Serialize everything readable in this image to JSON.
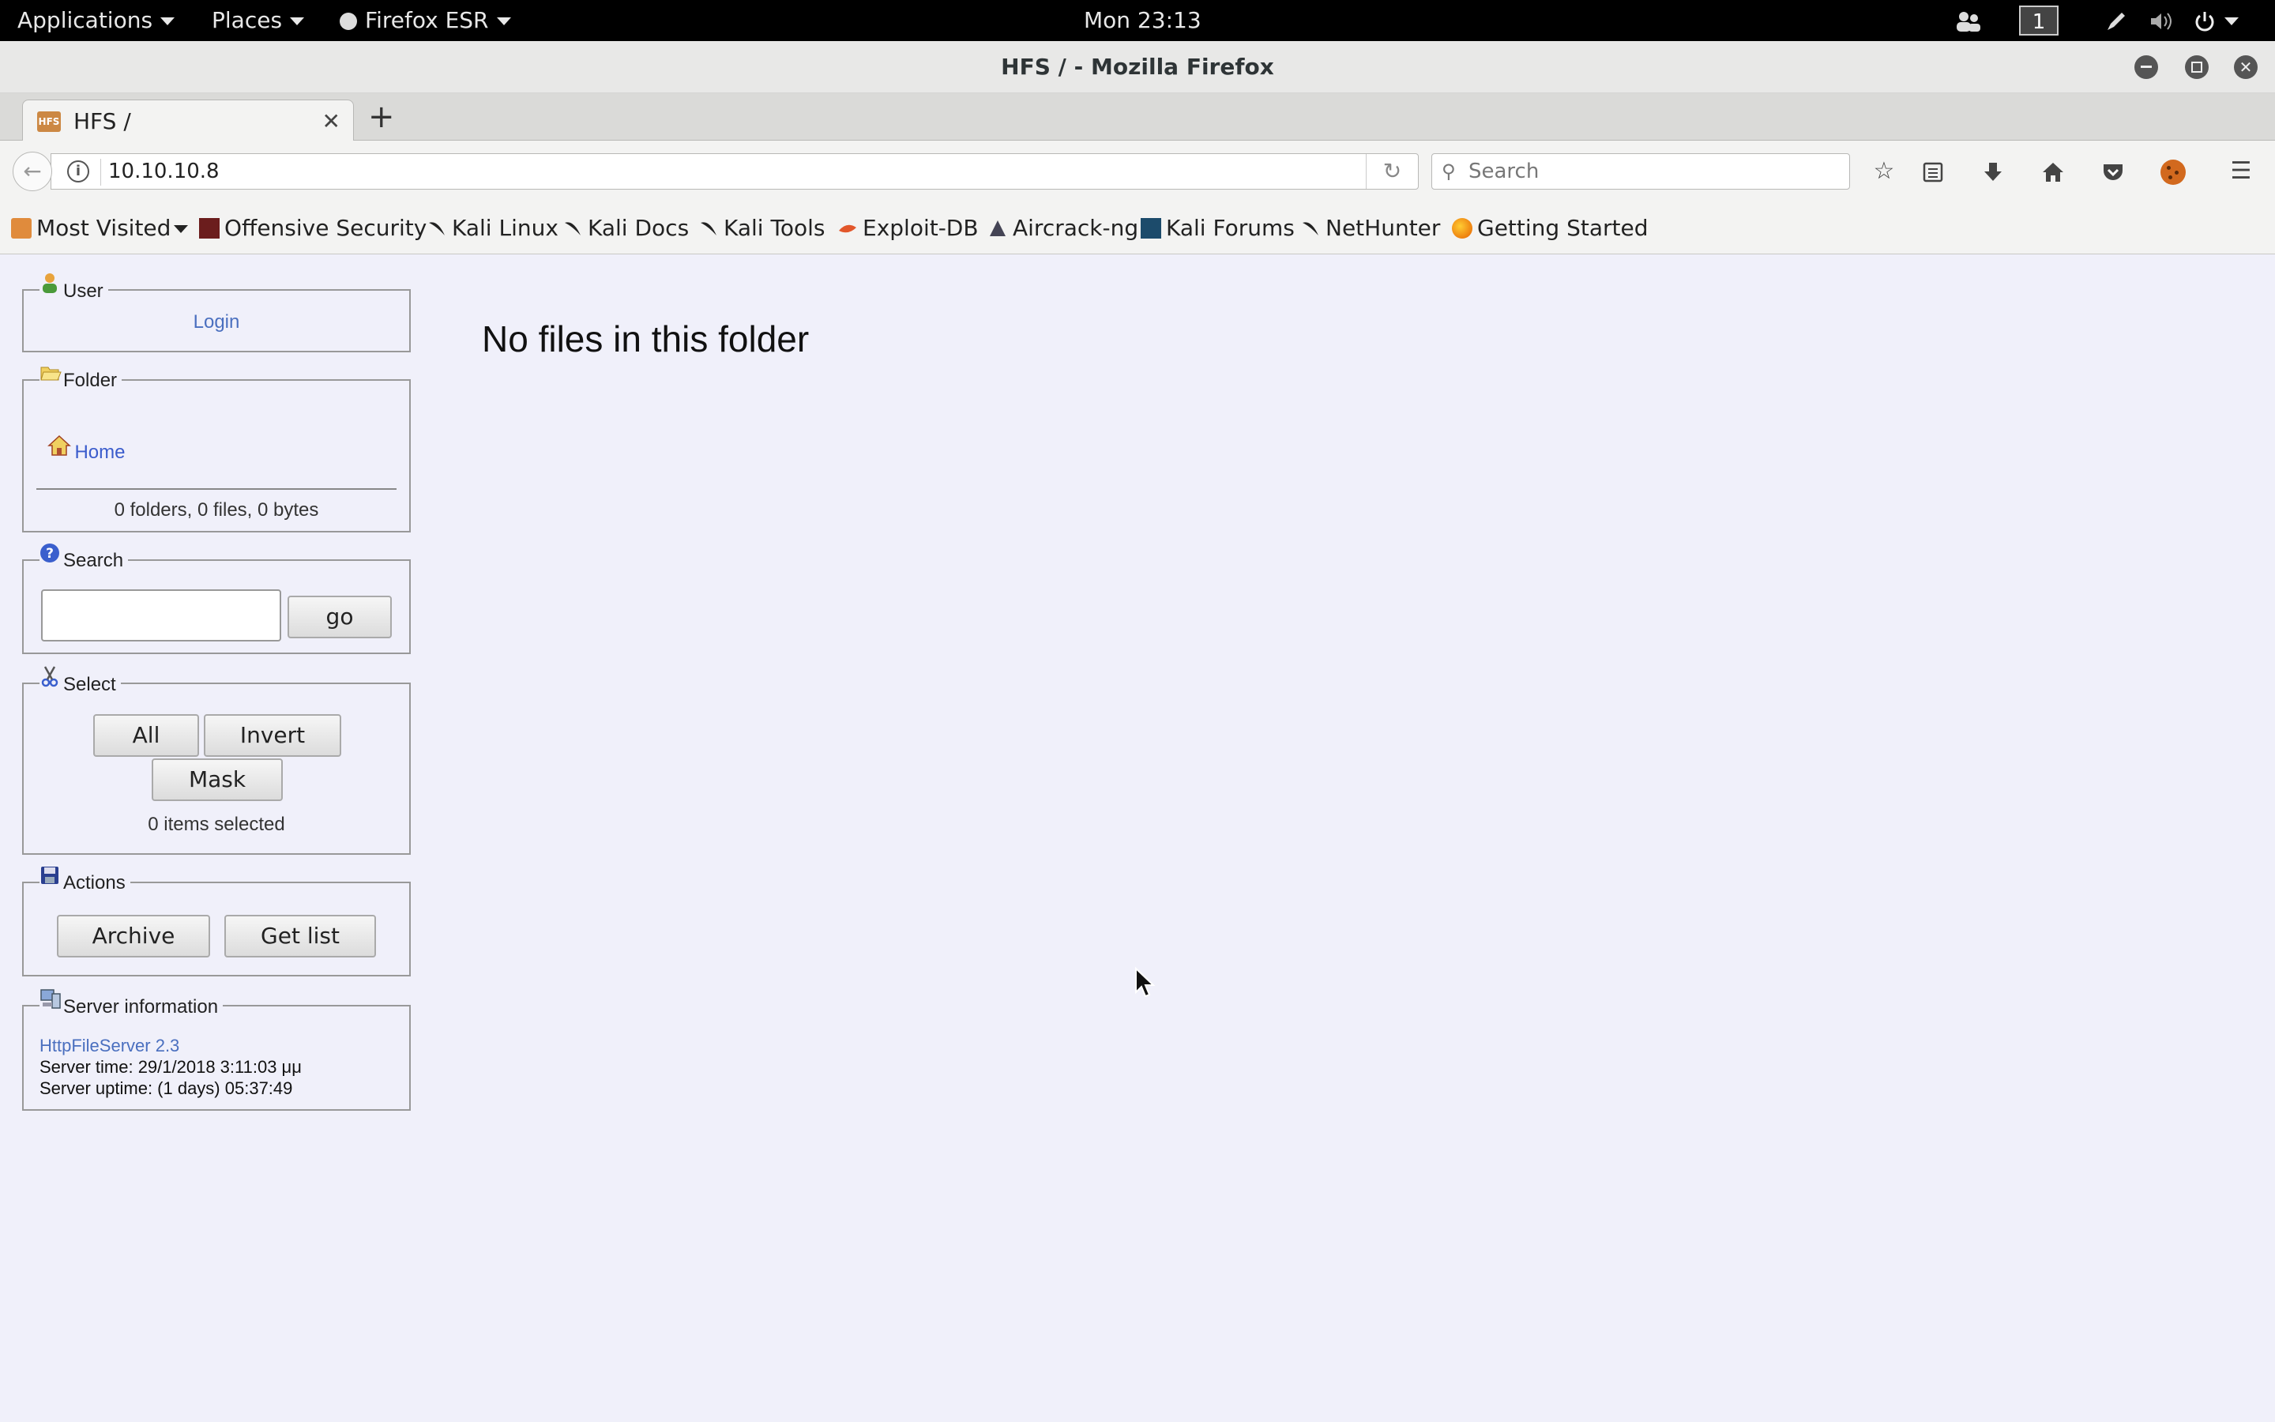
{
  "topbar": {
    "applications": "Applications",
    "places": "Places",
    "browser": "Firefox ESR",
    "clock": "Mon 23:13",
    "workspace": "1"
  },
  "window": {
    "title": "HFS / - Mozilla Firefox"
  },
  "tab": {
    "title": "HFS /",
    "favicon_text": "HFS"
  },
  "navbar": {
    "url": "10.10.10.8",
    "search_placeholder": "Search"
  },
  "bookmarks": [
    {
      "label": "Most Visited",
      "icon": "most-visited-icon"
    },
    {
      "label": "Offensive Security",
      "icon": "offsec-icon"
    },
    {
      "label": "Kali Linux",
      "icon": "kali-icon"
    },
    {
      "label": "Kali Docs",
      "icon": "kali-icon"
    },
    {
      "label": "Kali Tools",
      "icon": "kali-icon"
    },
    {
      "label": "Exploit-DB",
      "icon": "exploitdb-icon"
    },
    {
      "label": "Aircrack-ng",
      "icon": "aircrack-icon"
    },
    {
      "label": "Kali Forums",
      "icon": "kali-forums-icon"
    },
    {
      "label": "NetHunter",
      "icon": "kali-icon"
    },
    {
      "label": "Getting Started",
      "icon": "firefox-icon"
    }
  ],
  "sidebar": {
    "user": {
      "title": "User",
      "login": "Login"
    },
    "folder": {
      "title": "Folder",
      "home": "Home",
      "stats": "0 folders, 0 files, 0 bytes"
    },
    "search": {
      "title": "Search",
      "value": "",
      "go": "go"
    },
    "select": {
      "title": "Select",
      "all": "All",
      "invert": "Invert",
      "mask": "Mask",
      "status": "0 items selected"
    },
    "actions": {
      "title": "Actions",
      "archive": "Archive",
      "get_list": "Get list"
    },
    "server": {
      "title": "Server information",
      "link": "HttpFileServer 2.3",
      "time": "Server time: 29/1/2018 3:11:03 μμ",
      "uptime": "Server uptime: (1 days) 05:37:49"
    }
  },
  "main": {
    "heading": "No files in this folder"
  },
  "colors": {
    "page_bg": "#f0f0fa",
    "link": "#4a6fbf",
    "topbar_bg": "#000000"
  }
}
